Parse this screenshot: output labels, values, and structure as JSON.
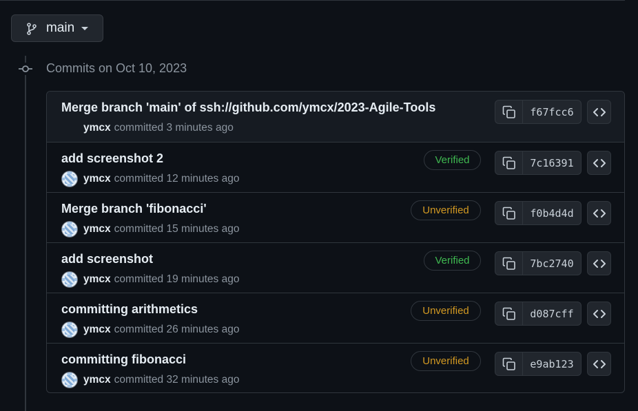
{
  "branch": {
    "name": "main",
    "icon": "git-branch-icon"
  },
  "heading": "Commits on Oct 10, 2023",
  "colors": {
    "bg": "#0d1117",
    "verified": "#3fb950",
    "unverified": "#d29922",
    "muted": "#8b949e"
  },
  "commits": [
    {
      "title": "Merge branch 'main' of ssh://github.com/ymcx/2023-Agile-Tools",
      "author": "ymcx",
      "action": "committed",
      "time": "3 minutes ago",
      "badge": "",
      "sha": "f67fcc6"
    },
    {
      "title": "add screenshot 2",
      "author": "ymcx",
      "action": "committed",
      "time": "12 minutes ago",
      "badge": "Verified",
      "sha": "7c16391"
    },
    {
      "title": "Merge branch 'fibonacci'",
      "author": "ymcx",
      "action": "committed",
      "time": "15 minutes ago",
      "badge": "Unverified",
      "sha": "f0b4d4d"
    },
    {
      "title": "add screenshot",
      "author": "ymcx",
      "action": "committed",
      "time": "19 minutes ago",
      "badge": "Verified",
      "sha": "7bc2740"
    },
    {
      "title": "committing arithmetics",
      "author": "ymcx",
      "action": "committed",
      "time": "26 minutes ago",
      "badge": "Unverified",
      "sha": "d087cff"
    },
    {
      "title": "committing fibonacci",
      "author": "ymcx",
      "action": "committed",
      "time": "32 minutes ago",
      "badge": "Unverified",
      "sha": "e9ab123"
    }
  ]
}
